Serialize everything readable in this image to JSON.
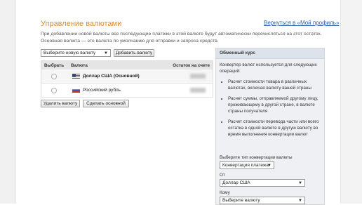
{
  "page": {
    "title": "Управление валютами",
    "back_link": "Вернуться в «Мой профиль»",
    "info_text": "При добавлении новой валюты все последующие платежи в этой валюте будут автоматически перечисляться на этот остаток. Основная валюта — это валюта по умолчанию для отправки и запроса средств."
  },
  "toolbar": {
    "new_currency_select": "Выберите новую валюту",
    "add_button": "Добавить валюту"
  },
  "table": {
    "headers": {
      "select": "Выбрать",
      "currency": "Валюта",
      "balance": "Остаток на счете"
    },
    "rows": [
      {
        "name": "Доллар США (Основной)",
        "flag": "us-flag-icon",
        "bold": true
      },
      {
        "name": "Российский рубль",
        "flag": "ru-flag-icon",
        "bold": false
      }
    ]
  },
  "actions": {
    "delete_button": "Удалить валюту",
    "make_primary_button": "Сделать основной"
  },
  "exchange": {
    "header": "Обменный курс",
    "intro": "Конвертер валют используется для следующих операций:",
    "bullets": [
      "Расчет стоимости товара в различных валютах, включая валюту вашей страны",
      "Расчет суммы, отправляемой другому лицу, проживающему в другой стране, в валюте страны получателя",
      "Расчет стоимости перевода части или всего остатка в одной валюте в другую валюту во время выполнения конвертации валют"
    ],
    "conversion_type_label": "Выберите тип конвертации валюты",
    "conversion_type_value": "Конвертация платежа",
    "from_label": "От",
    "from_value": "Доллар США",
    "to_label": "Кому",
    "to_value": "Выберите валюту"
  }
}
